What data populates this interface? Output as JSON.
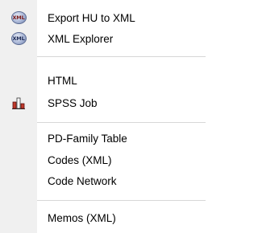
{
  "menu": {
    "items": [
      {
        "label": "Export HU to XML",
        "icon": "xml-badge-icon",
        "badge_text": "XML"
      },
      {
        "label": "XML Explorer",
        "icon": "xml-badge-icon",
        "badge_text": "XML"
      },
      {
        "label": "HTML",
        "icon": null
      },
      {
        "label": "SPSS Job",
        "icon": "bar-chart-icon"
      },
      {
        "label": "PD-Family Table",
        "icon": null
      },
      {
        "label": "Codes (XML)",
        "icon": null
      },
      {
        "label": "Code Network",
        "icon": null
      },
      {
        "label": "Memos (XML)",
        "icon": null
      }
    ]
  },
  "colors": {
    "gutter": "#f0f0f0",
    "separator": "#d7d7d7",
    "chart_red": "#c0392b"
  }
}
